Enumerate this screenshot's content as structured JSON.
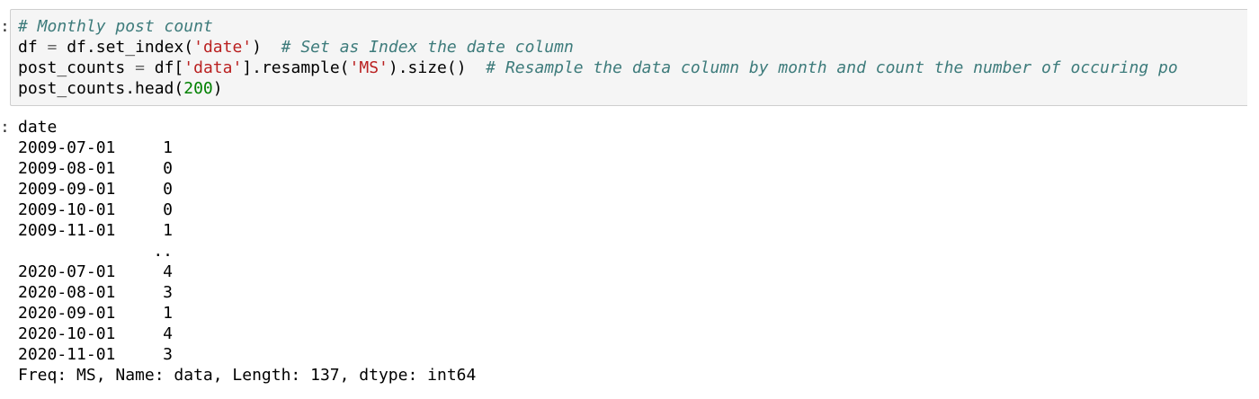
{
  "prompt_marks": {
    "input": ":",
    "output": ":"
  },
  "code": {
    "comment1": "# Monthly post count",
    "l2_a": "df",
    "l2_eq": "=",
    "l2_b": "df.set_index(",
    "l2_str": "'date'",
    "l2_c": ")",
    "l2_comment": "# Set as Index the date column",
    "l3_a": "post_counts",
    "l3_eq": "=",
    "l3_b": "df[",
    "l3_str1": "'data'",
    "l3_c": "].resample(",
    "l3_str2": "'MS'",
    "l3_d": ").size()",
    "l3_comment": "# Resample the data column by month and count the number of occuring po",
    "l4_a": "post_counts.head(",
    "l4_num": "200",
    "l4_b": ")"
  },
  "output": {
    "header": "date",
    "rows_top": [
      {
        "date": "2009-07-01",
        "count": "1"
      },
      {
        "date": "2009-08-01",
        "count": "0"
      },
      {
        "date": "2009-09-01",
        "count": "0"
      },
      {
        "date": "2009-10-01",
        "count": "0"
      },
      {
        "date": "2009-11-01",
        "count": "1"
      }
    ],
    "ellipsis": "..",
    "rows_bottom": [
      {
        "date": "2020-07-01",
        "count": "4"
      },
      {
        "date": "2020-08-01",
        "count": "3"
      },
      {
        "date": "2020-09-01",
        "count": "1"
      },
      {
        "date": "2020-10-01",
        "count": "4"
      },
      {
        "date": "2020-11-01",
        "count": "3"
      }
    ],
    "footer": "Freq: MS, Name: data, Length: 137, dtype: int64"
  },
  "colors": {
    "comment": "#3d7b7b",
    "string": "#ba2121",
    "number": "#008000",
    "operator": "#666666",
    "cell_background": "#f5f5f5",
    "cell_border": "#cfcfcf"
  }
}
